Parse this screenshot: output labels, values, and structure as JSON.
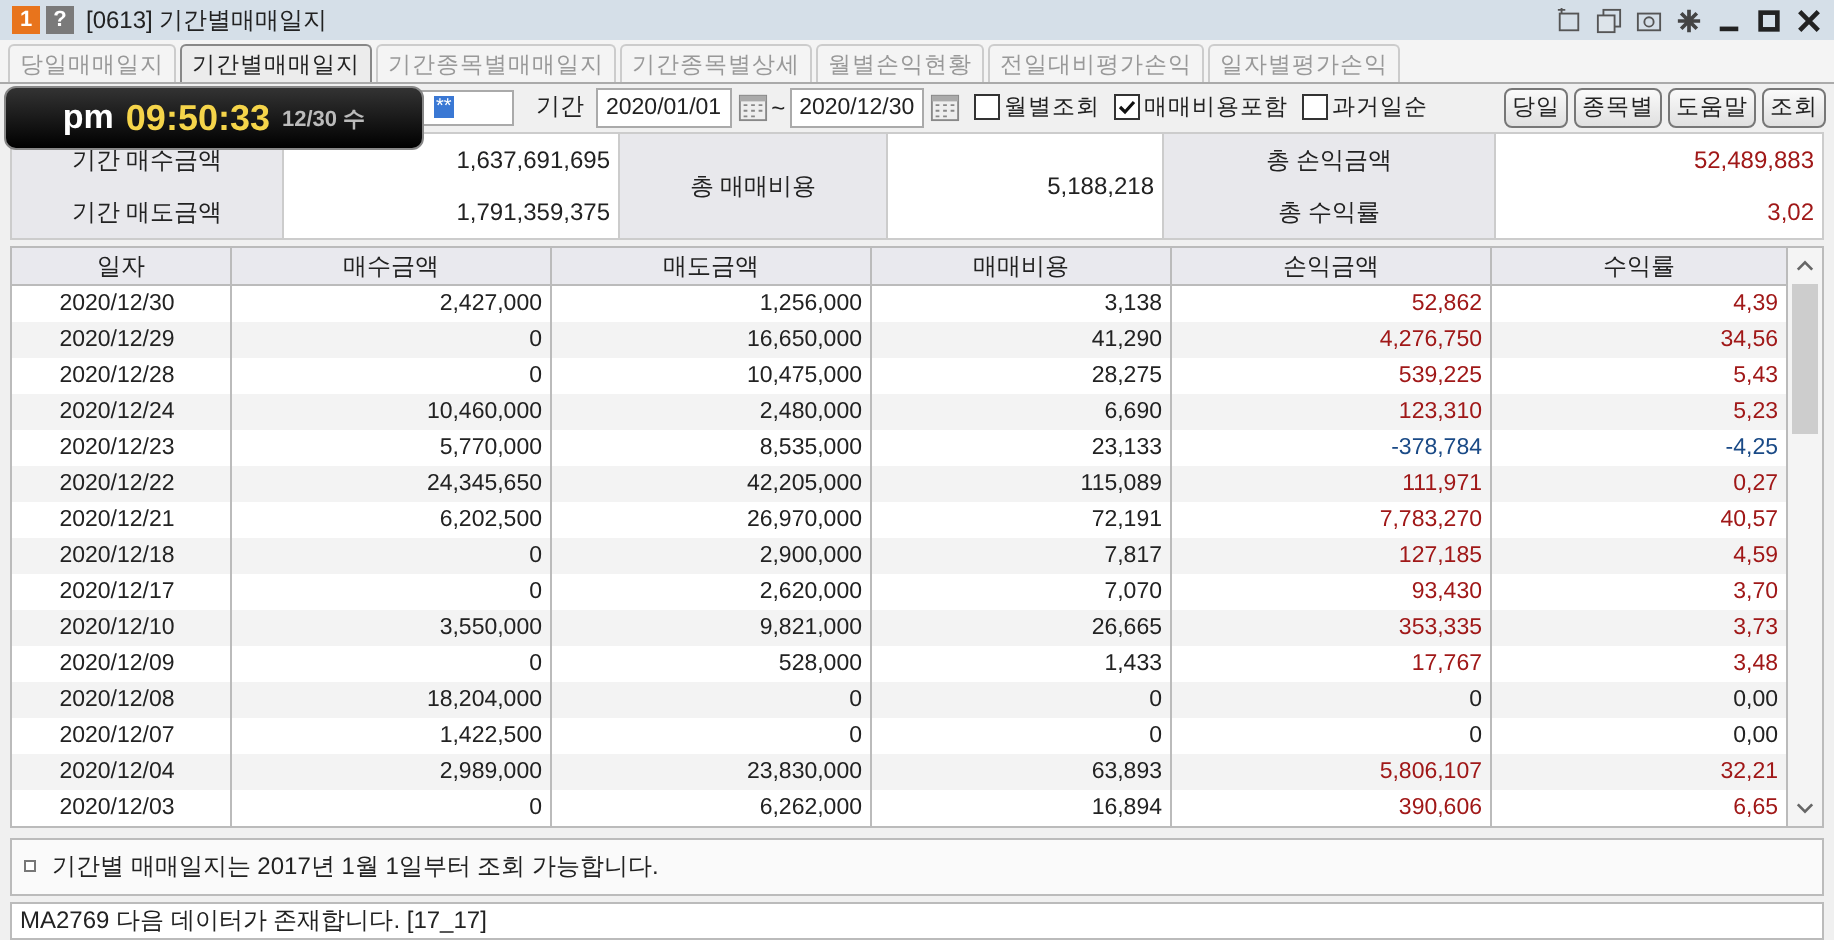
{
  "window": {
    "badge": "1",
    "help": "?",
    "title": "[0613] 기간별매매일지"
  },
  "tabs": [
    {
      "label": "당일매매일지",
      "selected": false
    },
    {
      "label": "기간별매매일지",
      "selected": true
    },
    {
      "label": "기간종목별매매일지",
      "selected": false
    },
    {
      "label": "기간종목별상세",
      "selected": false
    },
    {
      "label": "월별손익현황",
      "selected": false
    },
    {
      "label": "전일대비평가손익",
      "selected": false
    },
    {
      "label": "일자별평가손익",
      "selected": false
    }
  ],
  "clock": {
    "ampm": "pm",
    "time": "09:50:33",
    "date": "12/30 수"
  },
  "toolbar": {
    "account_value": "**",
    "period_label": "기간",
    "from": "2020/01/01",
    "separator": "~",
    "to": "2020/12/30",
    "checkboxes": [
      {
        "label": "월별조회",
        "checked": false
      },
      {
        "label": "매매비용포함",
        "checked": true
      },
      {
        "label": "과거일순",
        "checked": false
      }
    ],
    "buttons": [
      "당일",
      "종목별",
      "도움말",
      "조회"
    ]
  },
  "summary": {
    "buy_label": "기간 매수금액",
    "buy_value": "1,637,691,695",
    "sell_label": "기간 매도금액",
    "sell_value": "1,791,359,375",
    "cost_label": "총 매매비용",
    "cost_value": "5,188,218",
    "profit_label": "총 손익금액",
    "profit_value": "52,489,883",
    "rate_label": "총 수익률",
    "rate_value": "3,02"
  },
  "table": {
    "columns": [
      "일자",
      "매수금액",
      "매도금액",
      "매매비용",
      "손익금액",
      "수익률"
    ],
    "rows": [
      {
        "color": "#a01818",
        "cells": [
          "2020/12/30",
          "2,427,000",
          "1,256,000",
          "3,138",
          "52,862",
          "4,39"
        ]
      },
      {
        "color": "#a01818",
        "cells": [
          "2020/12/29",
          "0",
          "16,650,000",
          "41,290",
          "4,276,750",
          "34,56"
        ]
      },
      {
        "color": "#a01818",
        "cells": [
          "2020/12/28",
          "0",
          "10,475,000",
          "28,275",
          "539,225",
          "5,43"
        ]
      },
      {
        "color": "#a01818",
        "cells": [
          "2020/12/24",
          "10,460,000",
          "2,480,000",
          "6,690",
          "123,310",
          "5,23"
        ]
      },
      {
        "color": "#1a4a86",
        "cells": [
          "2020/12/23",
          "5,770,000",
          "8,535,000",
          "23,133",
          "-378,784",
          "-4,25"
        ]
      },
      {
        "color": "#a01818",
        "cells": [
          "2020/12/22",
          "24,345,650",
          "42,205,000",
          "115,089",
          "111,971",
          "0,27"
        ]
      },
      {
        "color": "#a01818",
        "cells": [
          "2020/12/21",
          "6,202,500",
          "26,970,000",
          "72,191",
          "7,783,270",
          "40,57"
        ]
      },
      {
        "color": "#a01818",
        "cells": [
          "2020/12/18",
          "0",
          "2,900,000",
          "7,817",
          "127,185",
          "4,59"
        ]
      },
      {
        "color": "#a01818",
        "cells": [
          "2020/12/17",
          "0",
          "2,620,000",
          "7,070",
          "93,430",
          "3,70"
        ]
      },
      {
        "color": "#a01818",
        "cells": [
          "2020/12/10",
          "3,550,000",
          "9,821,000",
          "26,665",
          "353,335",
          "3,73"
        ]
      },
      {
        "color": "#a01818",
        "cells": [
          "2020/12/09",
          "0",
          "528,000",
          "1,433",
          "17,767",
          "3,48"
        ]
      },
      {
        "color": "#222222",
        "cells": [
          "2020/12/08",
          "18,204,000",
          "0",
          "0",
          "0",
          "0,00"
        ]
      },
      {
        "color": "#222222",
        "cells": [
          "2020/12/07",
          "1,422,500",
          "0",
          "0",
          "0",
          "0,00"
        ]
      },
      {
        "color": "#a01818",
        "cells": [
          "2020/12/04",
          "2,989,000",
          "23,830,000",
          "63,893",
          "5,806,107",
          "32,21"
        ]
      },
      {
        "color": "#a01818",
        "cells": [
          "2020/12/03",
          "0",
          "6,262,000",
          "16,894",
          "390,606",
          "6,65"
        ]
      }
    ]
  },
  "notice": "기간별 매매일지는 2017년 1월 1일부터 조회 가능합니다.",
  "status": "MA2769 다음 데이터가 존재합니다. [17_17]"
}
